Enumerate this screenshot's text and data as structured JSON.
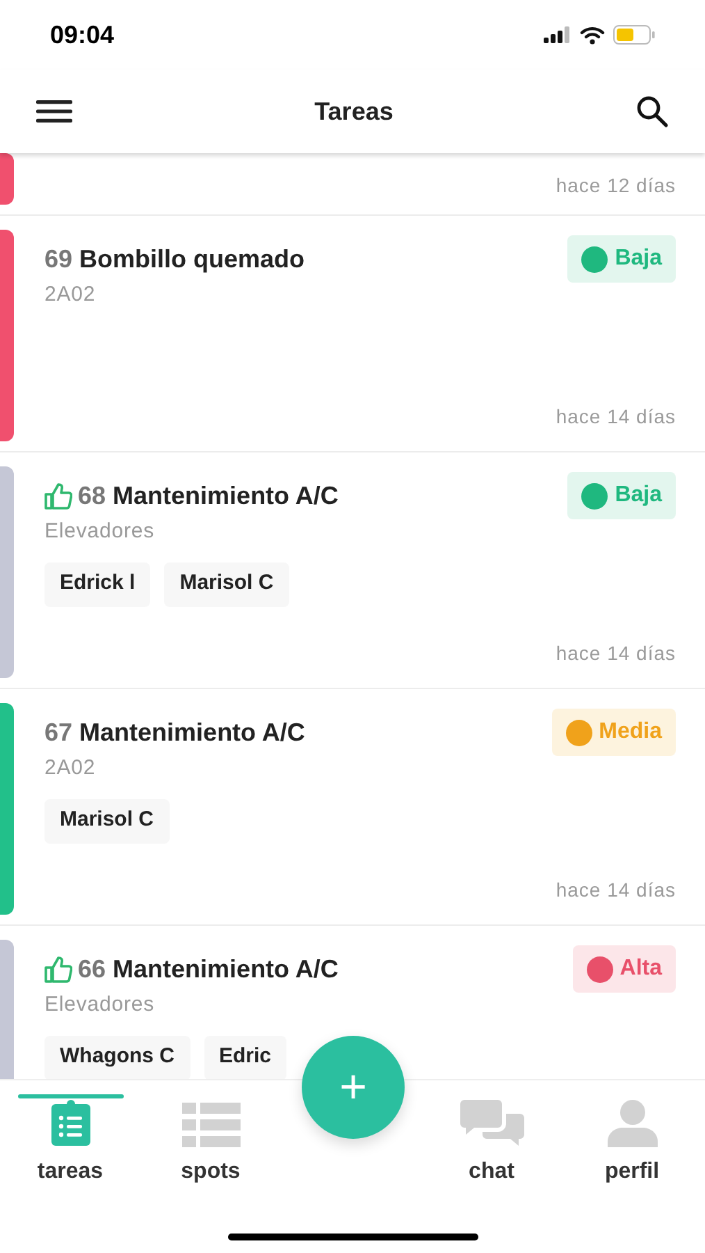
{
  "status_bar": {
    "time": "09:04"
  },
  "header": {
    "title": "Tareas"
  },
  "partial_task": {
    "color": "#f0506e",
    "age": "hace 12 días"
  },
  "tasks": [
    {
      "number": "69",
      "title": "Bombillo quemado",
      "location": "2A02",
      "liked": false,
      "color": "#f0506e",
      "priority": {
        "label": "Baja",
        "kind": "low"
      },
      "age": "hace 14 días"
    },
    {
      "number": "68",
      "title": "Mantenimiento A/C",
      "location": "Elevadores",
      "liked": true,
      "color": "#c5c7d6",
      "priority": {
        "label": "Baja",
        "kind": "low"
      },
      "assignees": [
        "Edrick l",
        "Marisol C"
      ],
      "age": "hace 14 días"
    },
    {
      "number": "67",
      "title": "Mantenimiento A/C",
      "location": "2A02",
      "liked": false,
      "color": "#22c08a",
      "priority": {
        "label": "Media",
        "kind": "medium"
      },
      "assignees": [
        "Marisol C"
      ],
      "age": "hace 14 días"
    },
    {
      "number": "66",
      "title": "Mantenimiento A/C",
      "location": "Elevadores",
      "liked": true,
      "color": "#c5c7d6",
      "priority": {
        "label": "Alta",
        "kind": "high"
      },
      "assignees": [
        "Whagons C",
        "Edric"
      ]
    }
  ],
  "fab": {
    "label": "+"
  },
  "nav": [
    {
      "label": "tareas",
      "kind": "tasks",
      "selected": true
    },
    {
      "label": "spots",
      "kind": "grid",
      "selected": false
    },
    {
      "label": "chat",
      "kind": "chat",
      "selected": false
    },
    {
      "label": "perfil",
      "kind": "profile",
      "selected": false
    }
  ]
}
